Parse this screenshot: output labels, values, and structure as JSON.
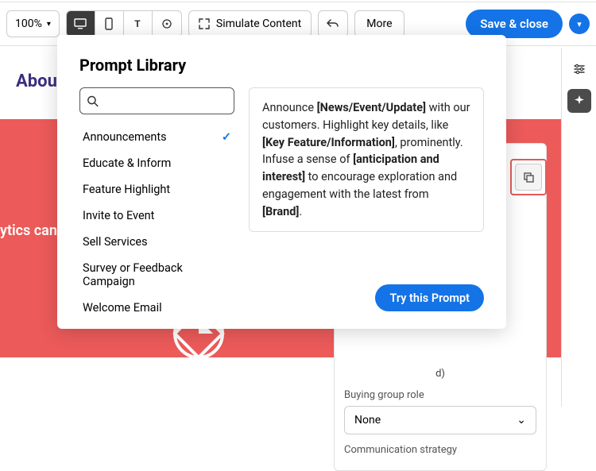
{
  "toolbar": {
    "zoom": "100%",
    "simulate_label": "Simulate Content",
    "more_label": "More",
    "save_label": "Save & close"
  },
  "background": {
    "header_text": "About",
    "red_text": "ytics can",
    "right_card_badge": "d)"
  },
  "right_panel": {
    "field_label": "Buying group role",
    "field_value": "None",
    "field2_label": "Communication strategy"
  },
  "modal": {
    "title": "Prompt Library",
    "search_placeholder": "",
    "categories": [
      {
        "label": "Announcements",
        "selected": true
      },
      {
        "label": "Educate & Inform",
        "selected": false
      },
      {
        "label": "Feature Highlight",
        "selected": false
      },
      {
        "label": "Invite to Event",
        "selected": false
      },
      {
        "label": "Sell Services",
        "selected": false
      },
      {
        "label": "Survey or Feedback Campaign",
        "selected": false
      },
      {
        "label": "Welcome Email",
        "selected": false
      }
    ],
    "preview": {
      "pre1": "Announce ",
      "b1": "[News/Event/Update]",
      "mid1": " with our customers. Highlight key details, like ",
      "b2": "[Key Feature/Information]",
      "mid2": ", prominently. Infuse a sense of ",
      "b3": "[anticipation and interest]",
      "mid3": " to encourage exploration and engagement with the latest from ",
      "b4": "[Brand]",
      "end": "."
    },
    "try_label": "Try this Prompt"
  }
}
